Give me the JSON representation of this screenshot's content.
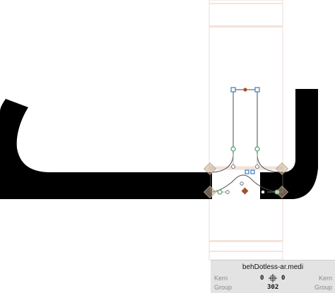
{
  "glyph": {
    "name": "behDotless-ar.medi"
  },
  "kern": {
    "label": "Kern",
    "left_value": "0",
    "right_value": "0",
    "right_label": "Kern",
    "link_icon": "kern-link-icon"
  },
  "group": {
    "label": "Group",
    "width_value": "302",
    "right_label": "Group"
  },
  "colors": {
    "glyph_fill": "#000000",
    "outline": "#4a4a4a",
    "node_blue": "#3a7cc2",
    "node_green": "#3aa860",
    "anchor": "#a0522d",
    "metric_line": "#f0e0d8",
    "panel_bg": "#e3e3e3"
  }
}
